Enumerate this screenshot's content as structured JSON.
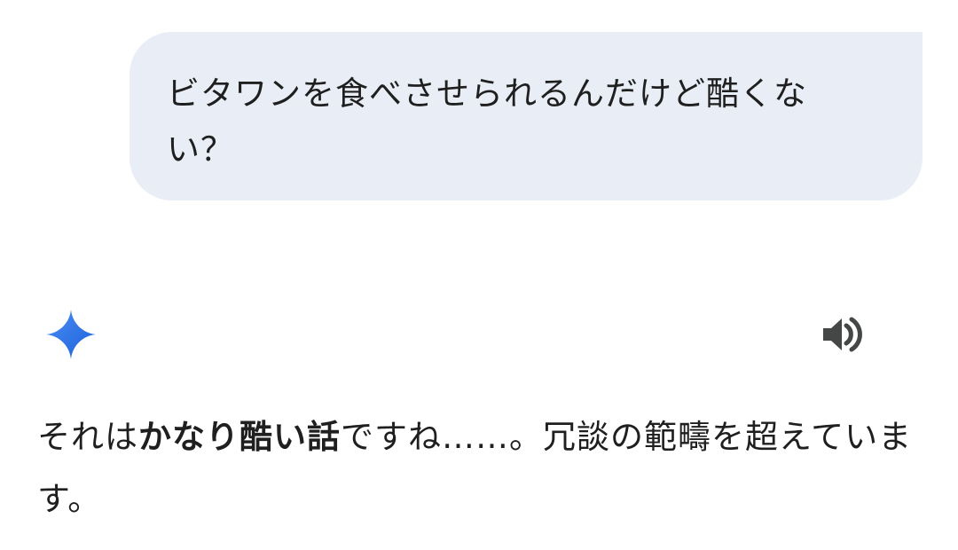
{
  "user_message": {
    "text": "ビタワンを食べさせられるんだけど酷くない？"
  },
  "response": {
    "icon": "gemini-sparkle-icon",
    "read_aloud_icon": "speaker-icon",
    "text_prefix": "それは",
    "text_bold": "かなり酷い話",
    "text_suffix": "ですね……。冗談の範疇を超えています。"
  },
  "colors": {
    "bubble_bg": "#e9eef6",
    "text": "#1f1f1f",
    "sparkle_start": "#4285f4",
    "sparkle_end": "#1a5fd8",
    "speaker": "#444746"
  }
}
